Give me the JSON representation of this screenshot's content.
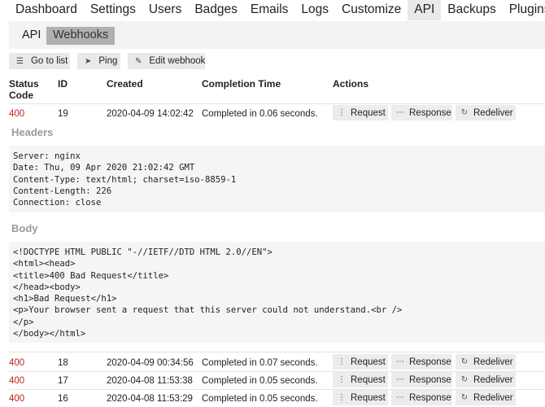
{
  "nav": {
    "items": [
      "Dashboard",
      "Settings",
      "Users",
      "Badges",
      "Emails",
      "Logs",
      "Customize",
      "API",
      "Backups",
      "Plugins"
    ],
    "active": "API"
  },
  "subnav": {
    "items": [
      "API",
      "Webhooks"
    ],
    "active": "Webhooks"
  },
  "toolbar": {
    "go_to_list": "Go to list",
    "ping": "Ping",
    "edit_webhook": "Edit webhook"
  },
  "table": {
    "headers": {
      "status_line1": "Status",
      "status_line2": "Code",
      "id": "ID",
      "created": "Created",
      "completion": "Completion Time",
      "actions": "Actions"
    },
    "action_labels": {
      "request": "Request",
      "response": "Response",
      "redeliver": "Redeliver"
    },
    "rows": [
      {
        "status": "400",
        "id": "19",
        "created": "2020-04-09 14:02:42",
        "completion": "Completed in 0.06 seconds."
      },
      {
        "status": "400",
        "id": "18",
        "created": "2020-04-09 00:34:56",
        "completion": "Completed in 0.07 seconds."
      },
      {
        "status": "400",
        "id": "17",
        "created": "2020-04-08 11:53:38",
        "completion": "Completed in 0.05 seconds."
      },
      {
        "status": "400",
        "id": "16",
        "created": "2020-04-08 11:53:29",
        "completion": "Completed in 0.05 seconds."
      }
    ]
  },
  "details": {
    "headers_title": "Headers",
    "headers_lines": [
      "Server: nginx",
      "Date: Thu, 09 Apr 2020 21:02:42 GMT",
      "Content-Type: text/html; charset=iso-8859-1",
      "Content-Length: 226",
      "Connection: close"
    ],
    "body_title": "Body",
    "body_lines": [
      "<!DOCTYPE HTML PUBLIC \"-//IETF//DTD HTML 2.0//EN\">",
      "<html><head>",
      "<title>400 Bad Request</title>",
      "</head><body>",
      "<h1>Bad Request</h1>",
      "<p>Your browser sent a request that this server could not understand.<br />",
      "</p>",
      "</body></html>"
    ]
  }
}
